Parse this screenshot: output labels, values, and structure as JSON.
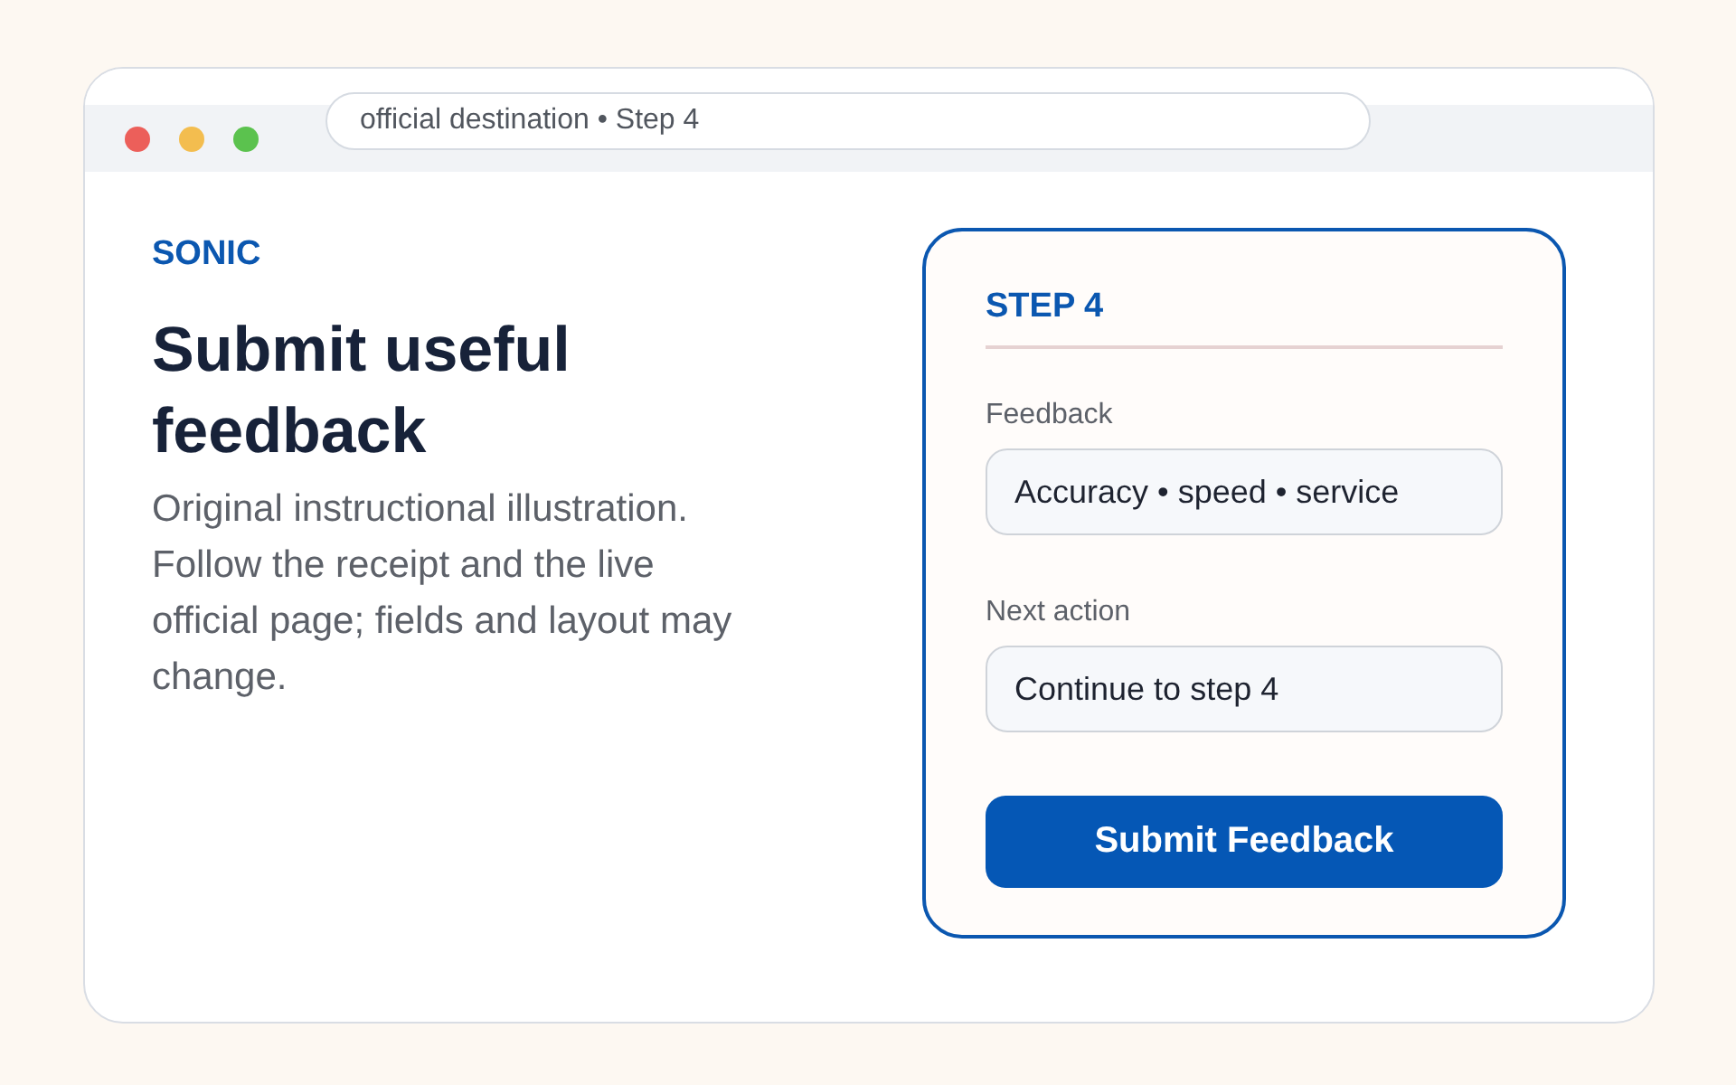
{
  "window": {
    "traffic_lights": [
      {
        "color": "#ec5f5a"
      },
      {
        "color": "#f3bd4f"
      },
      {
        "color": "#5bc24e"
      }
    ],
    "address": "official destination • Step 4"
  },
  "intro": {
    "brand": "SONIC",
    "heading": "Submit useful feedback",
    "body": "Original instructional illustration. Follow the receipt and the live official page; fields and layout may change."
  },
  "form": {
    "step": "STEP 4",
    "fields": [
      {
        "label": "Feedback",
        "value": "Accuracy • speed • service"
      },
      {
        "label": "Next action",
        "value": "Continue to step 4"
      }
    ],
    "submit": "Submit Feedback"
  }
}
